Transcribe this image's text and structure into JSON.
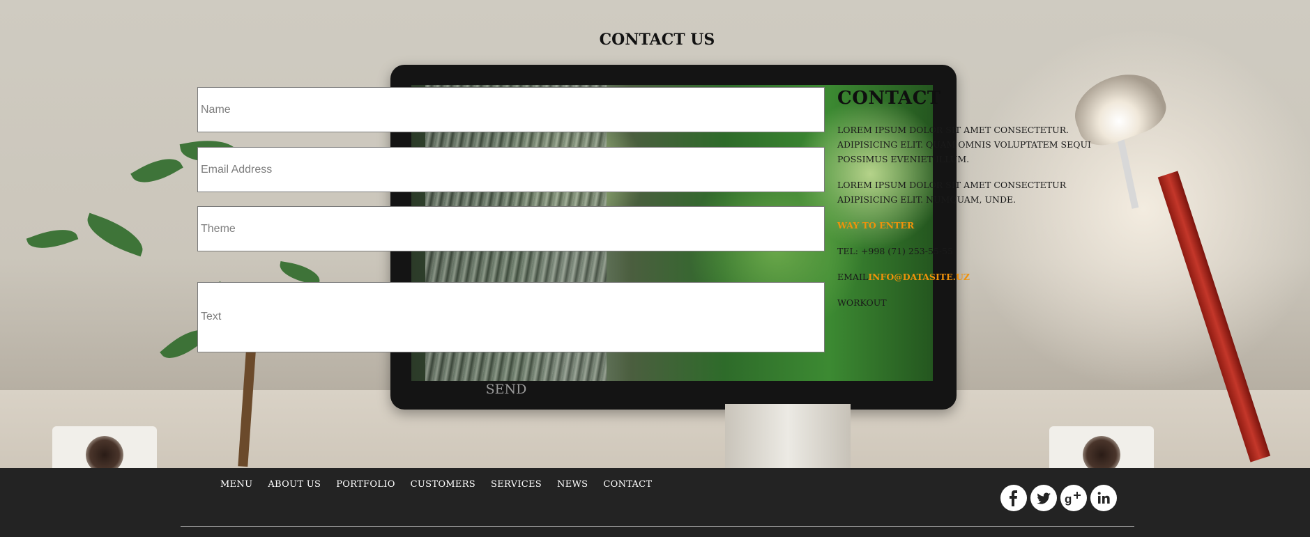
{
  "section": {
    "title": "CONTACT US"
  },
  "form": {
    "name_placeholder": "Name",
    "email_placeholder": "Email Address",
    "theme_placeholder": "Theme",
    "text_placeholder": "Text",
    "send_label": "SEND"
  },
  "contact": {
    "heading": "CONTACT",
    "paragraph1": "LOREM IPSUM DOLOR SIT AMET CONSECTETUR. ADIPISICING ELIT. QUAM OMNIS VOLUPTATEM SEQUI POSSIMUS EVENIET ILLUM.",
    "paragraph2": "LOREM IPSUM DOLOR SIT AMET CONSECTETUR ADIPISICING ELIT. NUMQUAM, UNDE.",
    "way_label": "WAY TO ENTER",
    "tel": "TEL: +998 (71) 253-55-55",
    "email_label": "EMAIL",
    "email_value": "INFO@DATASITE.UZ",
    "workout": "WORKOUT"
  },
  "footer": {
    "nav": [
      "MENU",
      "ABOUT US",
      "PORTFOLIO",
      "CUSTOMERS",
      "SERVICES",
      "NEWS",
      "CONTACT"
    ],
    "socials": [
      "facebook-icon",
      "twitter-icon",
      "google-plus-icon",
      "linkedin-icon"
    ]
  },
  "colors": {
    "accent": "#f0920a",
    "footer_bg": "#232323"
  }
}
